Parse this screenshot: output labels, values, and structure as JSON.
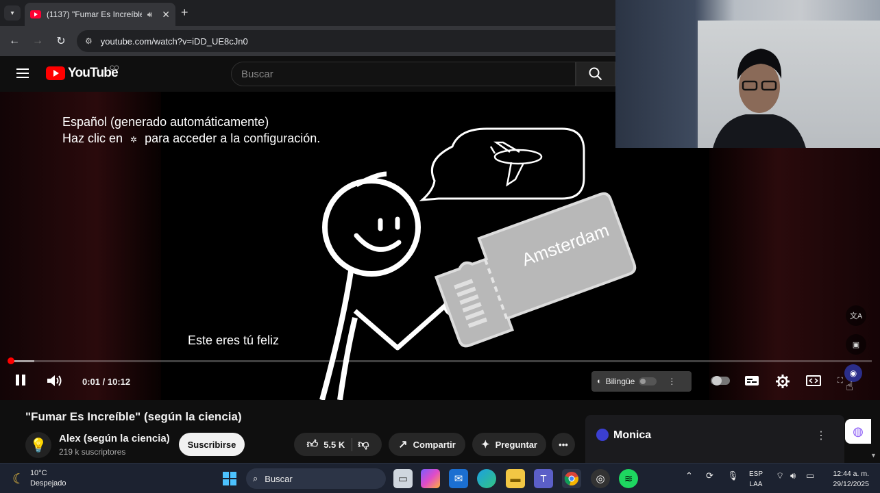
{
  "browser": {
    "tab_title": "(1137) \"Fumar Es Increíble\"",
    "url": "youtube.com/watch?v=iDD_UE8cJn0"
  },
  "youtube": {
    "logo_text": "YouTube",
    "country_code": "CO",
    "search_placeholder": "Buscar"
  },
  "video": {
    "caption_info_line1": "Español (generado automáticamente)",
    "caption_info_line2_a": "Haz clic en",
    "caption_info_line2_b": "para acceder a la configuración.",
    "subtitle": "Este eres tú feliz",
    "ticket_text": "Amsterdam",
    "time_display": "0:01 / 10:12",
    "progress_fraction": 0.0016,
    "buffer_fraction": 0.03,
    "bilingual_label": "Bilingüe"
  },
  "details": {
    "title": "\"Fumar Es Increíble\" (según la ciencia)",
    "channel_name": "Alex (según la ciencia)",
    "subscribers": "219 k suscriptores",
    "subscribe_label": "Suscribirse",
    "like_count": "5.5 K",
    "share_label": "Compartir",
    "ask_label": "Preguntar"
  },
  "monica": {
    "title": "Monica"
  },
  "taskbar": {
    "temperature": "10°C",
    "condition": "Despejado",
    "search_label": "Buscar",
    "lang_line1": "ESP",
    "lang_line2": "LAA",
    "time": "12:44 a. m.",
    "date": "29/12/2025"
  },
  "colors": {
    "accent_red": "#ff0000",
    "youtube_bg": "#0f0f0f"
  }
}
